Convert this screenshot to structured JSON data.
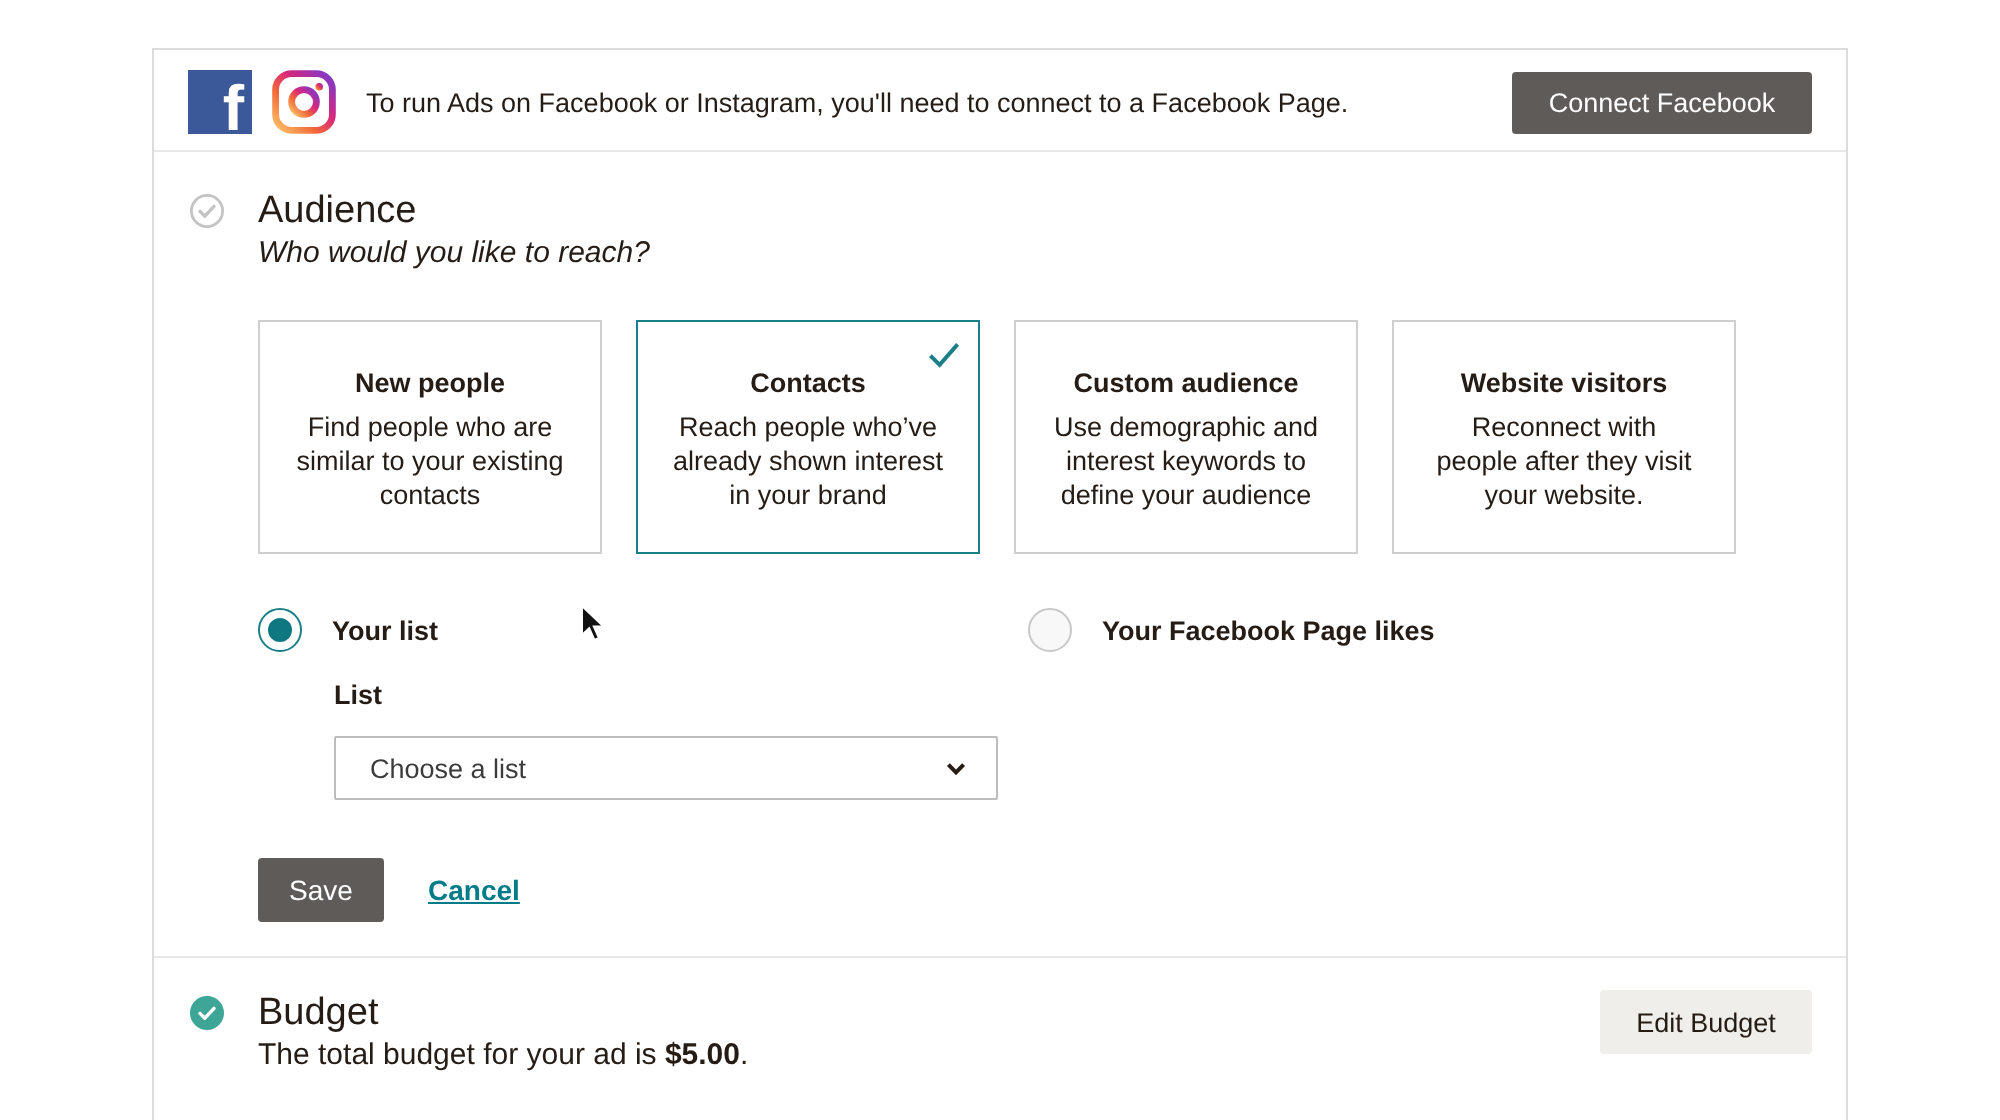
{
  "banner": {
    "logo_letter": "f",
    "message": "To run Ads on Facebook or Instagram, you'll need to connect to a Facebook Page.",
    "button": "Connect Facebook"
  },
  "audience": {
    "title": "Audience",
    "complete": false,
    "subtitle": "Who would you like to reach?",
    "options": [
      {
        "title": "New people",
        "description": "Find people who are similar to your existing contacts",
        "selected": false
      },
      {
        "title": "Contacts",
        "description": "Reach people who’ve already shown interest in your brand",
        "selected": true
      },
      {
        "title": "Custom audience",
        "description": "Use demographic and interest keywords to define your audience",
        "selected": false
      },
      {
        "title": "Website visitors",
        "description": "Reconnect with people after they visit your website.",
        "selected": false
      }
    ],
    "sources": [
      {
        "label": "Your list",
        "selected": true
      },
      {
        "label": "Your Facebook Page likes",
        "selected": false
      }
    ],
    "list_field": {
      "label": "List",
      "placeholder": "Choose a list"
    },
    "save_button": "Save",
    "cancel_link": "Cancel"
  },
  "budget": {
    "title": "Budget",
    "complete": true,
    "summary": "The total budget for your ad is **$5.00**.",
    "button": "Edit Budget"
  }
}
